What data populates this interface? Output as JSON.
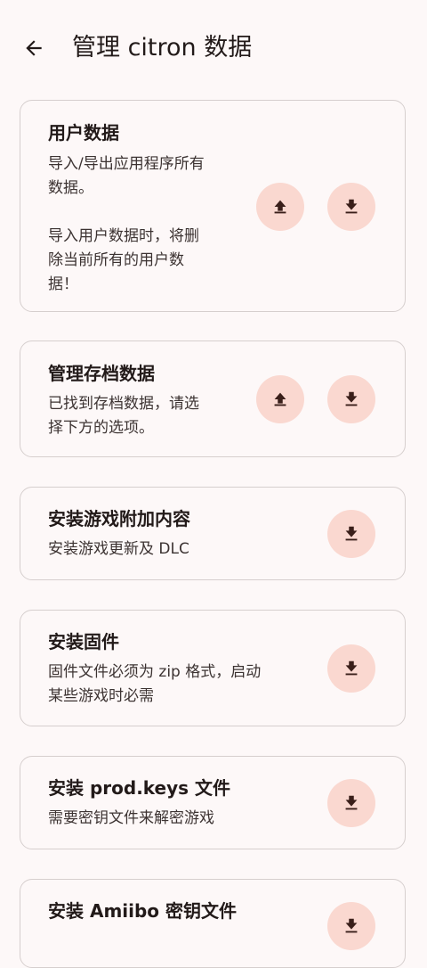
{
  "header": {
    "back_icon": "arrow-back-icon",
    "title": "管理 citron 数据"
  },
  "colors": {
    "background": "#fdf8f8",
    "card_border": "#d6cfce",
    "button_bg": "#fad8d0",
    "icon": "#3a1f1a"
  },
  "cards": [
    {
      "title": "用户数据",
      "desc_lines_1": [
        "导入/导出应用程序所有",
        "数据。"
      ],
      "desc_lines_2": [
        "导入用户数据时，将删",
        "除当前所有的用户数",
        "据！"
      ],
      "buttons": [
        "upload-icon",
        "download-icon"
      ]
    },
    {
      "title": "管理存档数据",
      "desc_lines": [
        "已找到存档数据，请选",
        "择下方的选项。"
      ],
      "buttons": [
        "upload-icon",
        "download-icon"
      ]
    },
    {
      "title": "安装游戏附加内容",
      "desc_lines": [
        "安装游戏更新及 DLC"
      ],
      "buttons": [
        "download-icon"
      ]
    },
    {
      "title": "安装固件",
      "desc_lines": [
        "固件文件必须为 zip 格式，启动",
        "某些游戏时必需"
      ],
      "buttons": [
        "download-icon"
      ]
    },
    {
      "title": "安装 prod.keys 文件",
      "desc_lines": [
        "需要密钥文件来解密游戏"
      ],
      "buttons": [
        "download-icon"
      ]
    },
    {
      "title": "安装 Amiibo 密钥文件",
      "desc_lines": [],
      "buttons": [
        "download-icon"
      ]
    }
  ]
}
